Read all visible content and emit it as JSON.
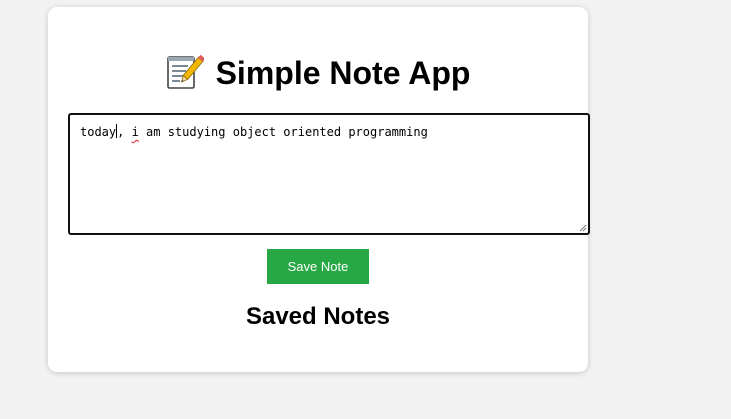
{
  "app": {
    "title": "Simple Note App",
    "title_icon": "memo-icon"
  },
  "editor": {
    "text_before_caret": "today",
    "text_after_caret": ", ",
    "misspelled_word": "i",
    "text_rest": " am studying object oriented programming"
  },
  "actions": {
    "save_label": "Save Note"
  },
  "notes": {
    "heading": "Saved Notes"
  },
  "colors": {
    "accent": "#28a745",
    "background": "#f2f2f2",
    "card": "#ffffff"
  }
}
